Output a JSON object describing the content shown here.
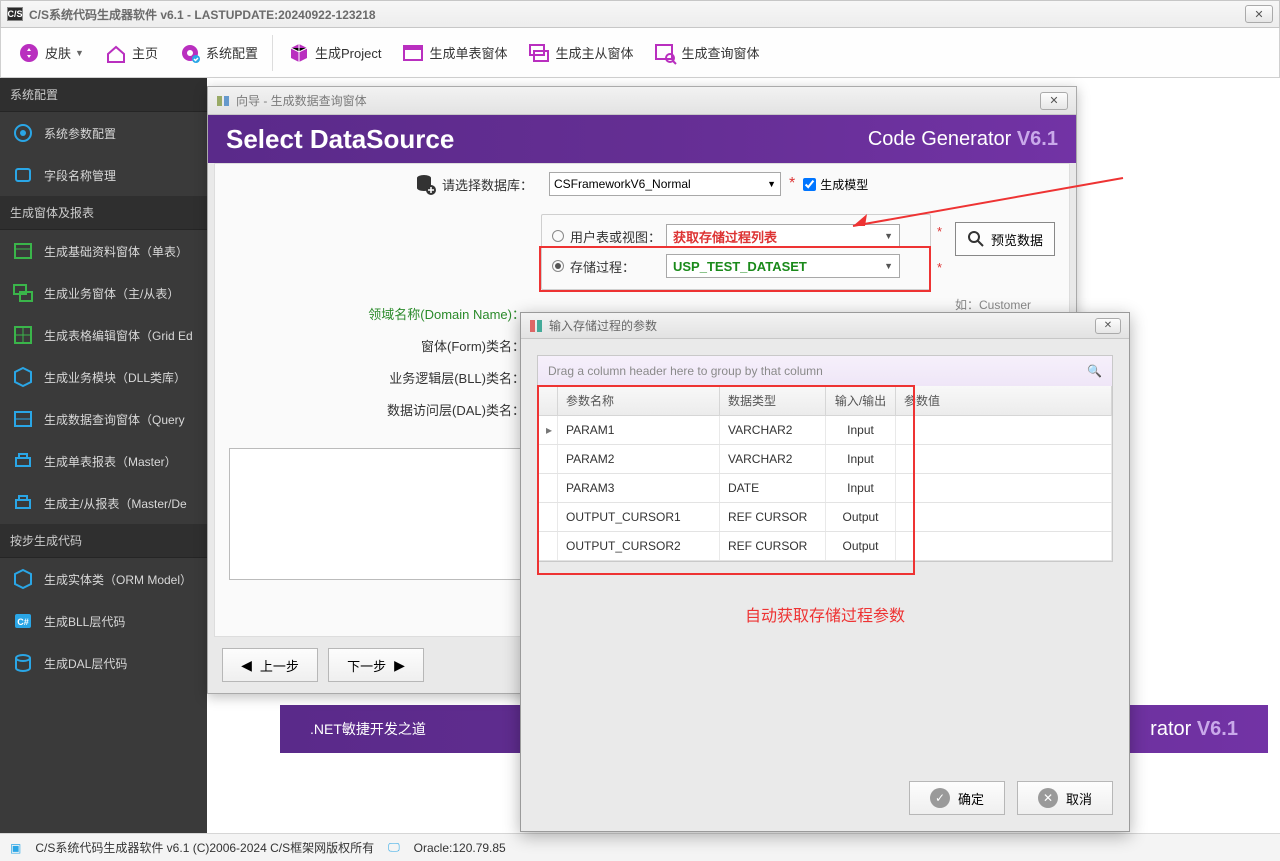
{
  "window": {
    "title": "C/S系统代码生成器软件 v6.1 - LASTUPDATE:20240922-123218",
    "app_icon_text": "C/S"
  },
  "toolbar": {
    "skin": "皮肤",
    "home": "主页",
    "config": "系统配置",
    "gen_project": "生成Project",
    "gen_single_form": "生成单表窗体",
    "gen_master_detail": "生成主从窗体",
    "gen_query_form": "生成查询窗体"
  },
  "sidebar": {
    "sec1": "系统配置",
    "items1": [
      "系统参数配置",
      "字段名称管理"
    ],
    "sec2": "生成窗体及报表",
    "items2": [
      "生成基础资料窗体（单表）",
      "生成业务窗体（主/从表）",
      "生成表格编辑窗体（Grid Ed",
      "生成业务模块（DLL类库）",
      "生成数据查询窗体（Query",
      "生成单表报表（Master）",
      "生成主/从报表（Master/De"
    ],
    "sec3": "按步生成代码",
    "items3": [
      "生成实体类（ORM Model）",
      "生成BLL层代码",
      "生成DAL层代码"
    ]
  },
  "wizard": {
    "title": "向导 - 生成数据查询窗体",
    "banner_title": "Select DataSource",
    "brand": "Code Generator",
    "brand_ver": "V6.1",
    "db_label": "请选择数据库：",
    "db_value": "CSFrameworkV6_Normal",
    "gen_model": "生成模型",
    "radio_user_table": "用户表或视图：",
    "radio_sp": "存储过程：",
    "user_table_value": "获取存储过程列表",
    "sp_value": "USP_TEST_DATASET",
    "preview": "预览数据",
    "domain_label": "领域名称(Domain Name)：",
    "hint": "如：Customer",
    "form_label": "窗体(Form)类名：",
    "bll_label": "业务逻辑层(BLL)类名：",
    "dal_label": "数据访问层(DAL)类名：",
    "prev": "上一步",
    "next": "下一步"
  },
  "purple_footer": {
    "text": ".NET敏捷开发之道",
    "brand": "rator",
    "ver": "V6.1"
  },
  "status": {
    "left": "C/S系统代码生成器软件 v6.1 (C)2006-2024 C/S框架网版权所有",
    "db": "Oracle:120.79.85"
  },
  "param_dialog": {
    "title": "输入存储过程的参数",
    "group_hint": "Drag a column header here to group by that column",
    "headers": {
      "name": "参数名称",
      "type": "数据类型",
      "io": "输入/输出",
      "val": "参数值"
    },
    "rows": [
      {
        "name": "PARAM1",
        "type": "VARCHAR2",
        "io": "Input"
      },
      {
        "name": "PARAM2",
        "type": "VARCHAR2",
        "io": "Input"
      },
      {
        "name": "PARAM3",
        "type": "DATE",
        "io": "Input"
      },
      {
        "name": "OUTPUT_CURSOR1",
        "type": "REF CURSOR",
        "io": "Output"
      },
      {
        "name": "OUTPUT_CURSOR2",
        "type": "REF CURSOR",
        "io": "Output"
      }
    ],
    "note": "自动获取存储过程参数",
    "ok": "确定",
    "cancel": "取消"
  }
}
